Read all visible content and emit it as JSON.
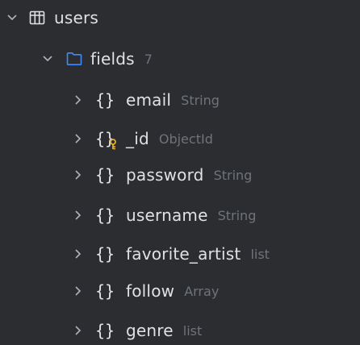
{
  "colors": {
    "background": "#2b2d30",
    "text": "#dfe1e5",
    "muted": "#6f737a",
    "folder": "#3d8bfd",
    "key": "#e0b12f"
  },
  "table": {
    "name": "users",
    "icon": "table-icon",
    "expanded": true
  },
  "fields_group": {
    "label": "fields",
    "count": "7",
    "icon": "folder-icon",
    "expanded": true
  },
  "fields": [
    {
      "name": "email",
      "type": "String",
      "icon": "object-icon"
    },
    {
      "name": "_id",
      "type": "ObjectId",
      "icon": "object-key-icon"
    },
    {
      "name": "password",
      "type": "String",
      "icon": "object-icon"
    },
    {
      "name": "username",
      "type": "String",
      "icon": "object-icon"
    },
    {
      "name": "favorite_artist",
      "type": "list",
      "icon": "object-icon"
    },
    {
      "name": "follow",
      "type": "Array",
      "icon": "object-icon"
    },
    {
      "name": "genre",
      "type": "list",
      "icon": "object-icon"
    }
  ]
}
